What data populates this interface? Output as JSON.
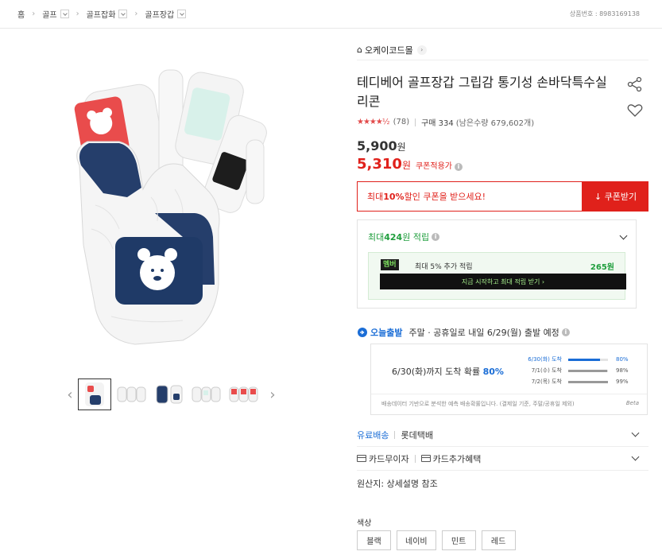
{
  "breadcrumb": [
    "홈",
    "골프",
    "골프잡화",
    "골프장갑"
  ],
  "product_no": "상품번호 : 8983169138",
  "store": {
    "name": "오케이코드몰"
  },
  "title": "테디베어 골프장갑 그립감 통기성 손바닥특수실리콘",
  "rating": {
    "stars": "★★★★½",
    "count": "(78)",
    "buy": "구매 334",
    "stock": "(남은수량 679,602개)"
  },
  "price": {
    "original": "5,900",
    "won": "원",
    "sale": "5,310",
    "coupon_label": "쿠폰적용가"
  },
  "coupon": {
    "text_pre": "최대 ",
    "rate": "10%",
    "text_post": " 할인 쿠폰을 받으세요!",
    "button": "↓ 쿠폰받기"
  },
  "points": {
    "title_pre": "최대 ",
    "amount": "424",
    "title_post": "원 적립",
    "member_badge": "멤버",
    "member_text": "최대 5% 추가 적립",
    "member_amount": "265원",
    "member_cta": "지금 시작하고 최대 적립 받기 ›"
  },
  "shipping": {
    "badge": "오늘출발",
    "text": "주말 · 공휴일로 내일 6/29(월) 출발 예정",
    "summary_pre": "6/30(화)까지 도착 확률 ",
    "summary_pct": "80%",
    "rows": [
      {
        "label": "6/30(화) 도착",
        "pct": "80%",
        "fill": 0.8
      },
      {
        "label": "7/1(수) 도착",
        "pct": "98%",
        "fill": 0.98
      },
      {
        "label": "7/2(목) 도착",
        "pct": "99%",
        "fill": 0.99
      }
    ],
    "note": "배송데이터 기반으로 분석한 예측 배송확률입니다. (결제일 기준, 주말/공휴일 제외)",
    "beta": "Beta"
  },
  "delivery": {
    "paid": "유료배송",
    "courier": "롯데택배"
  },
  "card": {
    "interest_free": "카드무이자",
    "benefit": "카드추가혜택"
  },
  "origin": "원산지: 상세설명 참조",
  "color": {
    "label": "색상",
    "options": [
      "블랙",
      "네이비",
      "민트",
      "레드"
    ]
  }
}
